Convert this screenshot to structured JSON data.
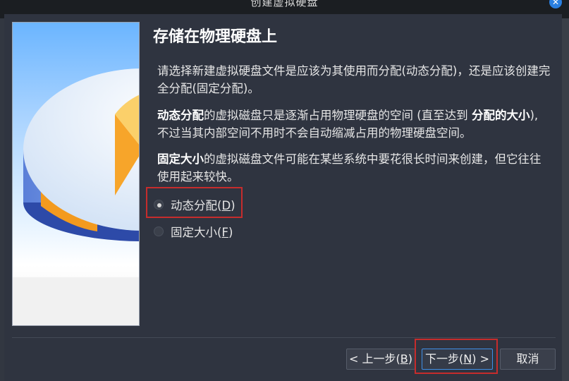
{
  "window": {
    "title": "创建虚拟硬盘"
  },
  "heading": "存储在物理硬盘上",
  "intro": "请选择新建虚拟硬盘文件是应该为其使用而分配(动态分配)，还是应该创建完全分配(固定分配)。",
  "dynamic_desc": {
    "bold1": "动态分配",
    "text1": "的虚拟磁盘只是逐渐占用物理硬盘的空间 (直至达到 ",
    "bold2": "分配的大小",
    "text2": "), 不过当其内部空间不用时不会自动缩减占用的物理硬盘空间。"
  },
  "fixed_desc": {
    "bold1": "固定大小",
    "text1": "的虚拟磁盘文件可能在某些系统中要花很长时间来创建，但它往往使用起来较快。"
  },
  "options": [
    {
      "label": "动态分配(",
      "mnemonic": "D",
      "suffix": ")",
      "checked": true
    },
    {
      "label": "固定大小(",
      "mnemonic": "F",
      "suffix": ")",
      "checked": false
    }
  ],
  "buttons": {
    "back": {
      "prefix": "< 上一步(",
      "mnemonic": "B",
      "suffix": ")"
    },
    "next": {
      "prefix": "下一步(",
      "mnemonic": "N",
      "suffix": ") >"
    },
    "cancel": "取消"
  },
  "colors": {
    "accent": "#3f8fe8",
    "highlight": "#c62c2c",
    "dialog_bg": "#2f3440"
  }
}
